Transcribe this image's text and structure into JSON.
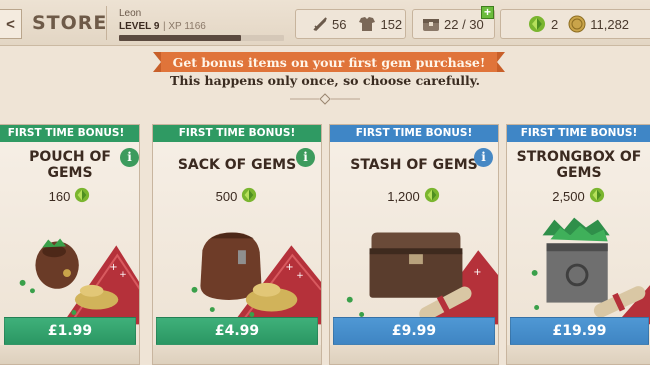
{
  "topbar": {
    "back_icon": "chevron-left-icon",
    "title": "STORE",
    "player_name": "Leon",
    "level": "LEVEL 9",
    "xp": "| XP 1166",
    "xp_progress": 0.74,
    "combat_power": "56",
    "armor": "152",
    "inventory": "22 / 30",
    "inventory_plus": "+",
    "gems": "2",
    "gold": "11,282"
  },
  "banner": {
    "headline": "Get bonus items on your first gem purchase!",
    "subtitle": "This happens only once, so choose carefully."
  },
  "colors": {
    "green": "#2f9a63",
    "blue": "#3f86c6",
    "orange": "#e0743a",
    "background": "#efe4d6"
  },
  "cards": [
    {
      "bonus": "FIRST TIME BONUS!",
      "name_line1": "POUCH OF",
      "name_line2": "GEMS",
      "amount": "160",
      "price": "£1.99",
      "theme": "green",
      "info": "i"
    },
    {
      "bonus": "FIRST TIME BONUS!",
      "name_line1": "SACK OF GEMS",
      "name_line2": "",
      "amount": "500",
      "price": "£4.99",
      "theme": "green",
      "info": "i"
    },
    {
      "bonus": "FIRST TIME BONUS!",
      "name_line1": "STASH OF GEMS",
      "name_line2": "",
      "amount": "1,200",
      "price": "£9.99",
      "theme": "blue",
      "info": "i"
    },
    {
      "bonus": "FIRST TIME BONUS!",
      "name_line1": "STRONGBOX OF",
      "name_line2": "GEMS",
      "amount": "2,500",
      "price": "£19.99",
      "theme": "blue",
      "info": ""
    }
  ]
}
